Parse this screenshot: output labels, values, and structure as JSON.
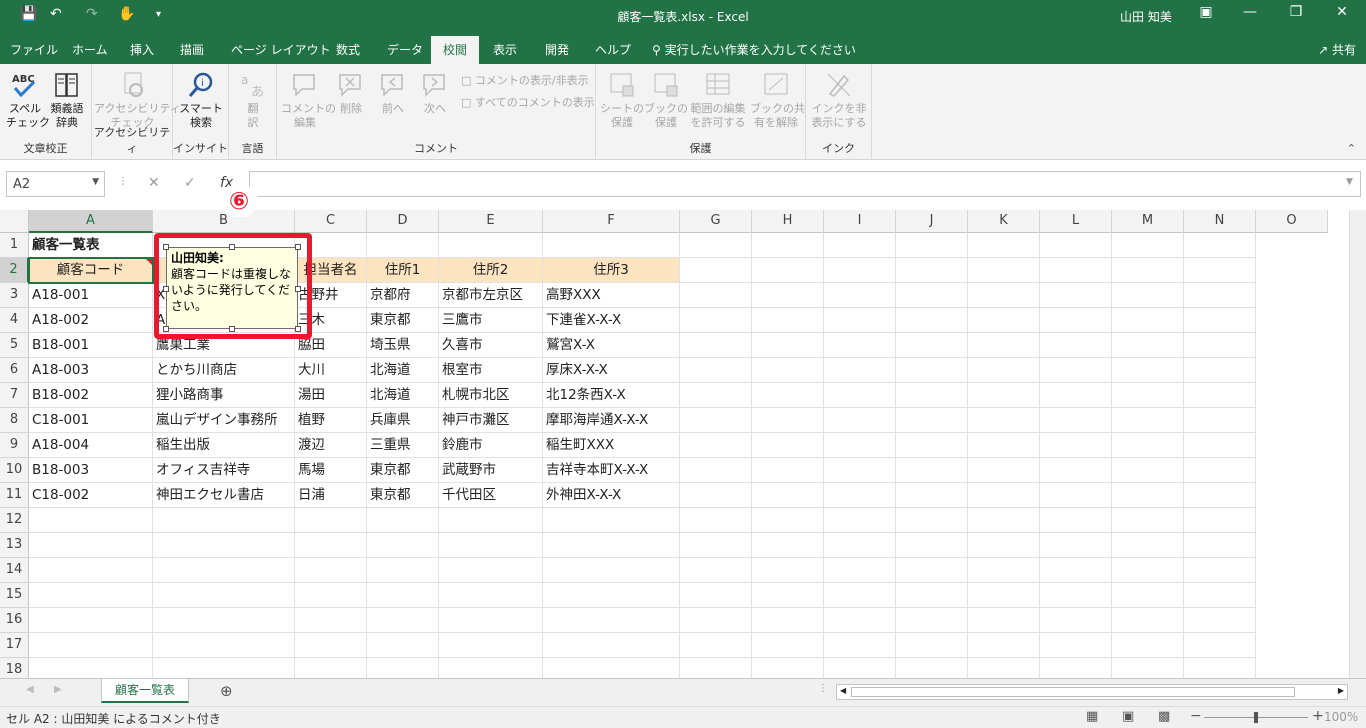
{
  "window": {
    "title": "顧客一覧表.xlsx  -  Excel",
    "user": "山田 知美"
  },
  "tabs": [
    "ファイル",
    "ホーム",
    "挿入",
    "描画",
    "ページ レイアウト",
    "数式",
    "データ",
    "校閲",
    "表示",
    "開発",
    "ヘルプ"
  ],
  "active_tab": "校閲",
  "tell_me": "実行したい作業を入力してください",
  "share_label": "共有",
  "ribbon": {
    "groups": [
      {
        "label": "文章校正",
        "buttons": [
          "スペル\nチェック",
          "類義語\n辞典"
        ]
      },
      {
        "label": "アクセシビリティ",
        "buttons": [
          "アクセシビリティ\nチェック"
        ]
      },
      {
        "label": "インサイト",
        "buttons": [
          "スマート\n検索"
        ]
      },
      {
        "label": "言語",
        "buttons": [
          "翻\n訳"
        ]
      },
      {
        "label": "コメント",
        "buttons": [
          "コメントの\n編集",
          "削除",
          "前へ",
          "次へ"
        ],
        "small": [
          "コメントの表示/非表示",
          "すべてのコメントの表示"
        ]
      },
      {
        "label": "保護",
        "buttons": [
          "シートの\n保護",
          "ブックの\n保護",
          "範囲の編集\nを許可する",
          "ブックの共\n有を解除"
        ]
      },
      {
        "label": "インク",
        "buttons": [
          "インクを非\n表示にする"
        ]
      }
    ]
  },
  "namebox": "A2",
  "columns": [
    "A",
    "B",
    "C",
    "D",
    "E",
    "F",
    "G",
    "H",
    "I",
    "J",
    "K",
    "L",
    "M",
    "N",
    "O"
  ],
  "rows": [
    [
      "顧客一覧表",
      "",
      "",
      "",
      "",
      ""
    ],
    [
      "顧客コード",
      "顧客名",
      "担当者名",
      "住所1",
      "住所2",
      "住所3"
    ],
    [
      "A18-001",
      "X",
      "古野井",
      "京都府",
      "京都市左京区",
      "高野XXX"
    ],
    [
      "A18-002",
      "A",
      "三木",
      "東京都",
      "三鷹市",
      "下連雀X-X-X"
    ],
    [
      "B18-001",
      "鷹巣工業",
      "脇田",
      "埼玉県",
      "久喜市",
      "鷲宮X-X"
    ],
    [
      "A18-003",
      "とかち川商店",
      "大川",
      "北海道",
      "根室市",
      "厚床X-X-X"
    ],
    [
      "B18-002",
      "狸小路商事",
      "湯田",
      "北海道",
      "札幌市北区",
      "北12条西X-X"
    ],
    [
      "C18-001",
      "嵐山デザイン事務所",
      "植野",
      "兵庫県",
      "神戸市灘区",
      "摩耶海岸通X-X-X"
    ],
    [
      "A18-004",
      "稲生出版",
      "渡辺",
      "三重県",
      "鈴鹿市",
      "稲生町XXX"
    ],
    [
      "B18-003",
      "オフィス吉祥寺",
      "馬場",
      "東京都",
      "武蔵野市",
      "吉祥寺本町X-X-X"
    ],
    [
      "C18-002",
      "神田エクセル書店",
      "日浦",
      "東京都",
      "千代田区",
      "外神田X-X-X"
    ]
  ],
  "row_numbers": [
    "1",
    "2",
    "3",
    "4",
    "5",
    "6",
    "7",
    "8",
    "9",
    "10",
    "11",
    "12",
    "13",
    "14",
    "15",
    "16",
    "17",
    "18"
  ],
  "comment": {
    "author": "山田知美:",
    "text": "顧客コードは重複しないように発行してください。"
  },
  "step_marker": "⑥",
  "sheet_tab": "顧客一覧表",
  "status": {
    "text": "セル A2 : 山田知美 によるコメント付き",
    "zoom": "100%"
  },
  "colors": {
    "excel_green": "#217346",
    "header_fill": "#fce4c0",
    "comment_fill": "#ffffe1",
    "highlight": "#e8192c"
  }
}
